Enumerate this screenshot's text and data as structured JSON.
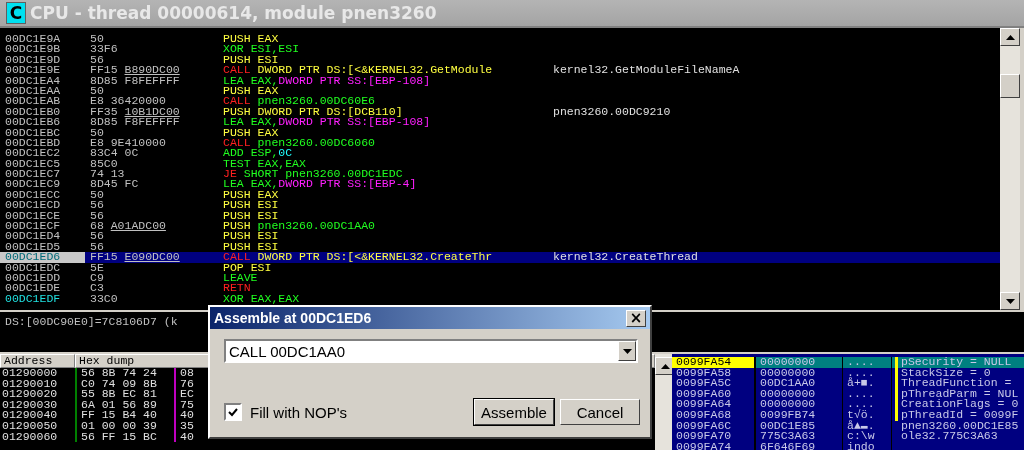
{
  "window": {
    "icon_letter": "C",
    "title": "CPU - thread 00000614, module pnen3260"
  },
  "disassembly": {
    "rows": [
      {
        "address": "00DC1E9A",
        "hex": "50",
        "asm": [
          {
            "text": "PUSH",
            "kind": "push"
          },
          {
            "text": "EAX",
            "kind": "push"
          }
        ],
        "comment": "",
        "selected": false,
        "highlighted": false
      },
      {
        "address": "00DC1E9B",
        "hex": "33F6",
        "asm": [
          {
            "text": "XOR",
            "kind": "cmd"
          },
          {
            "text": "ESI,ESI",
            "kind": "cmd"
          }
        ],
        "comment": "",
        "selected": false,
        "highlighted": false
      },
      {
        "address": "00DC1E9D",
        "hex": "56",
        "asm": [
          {
            "text": "PUSH",
            "kind": "push"
          },
          {
            "text": "ESI",
            "kind": "push"
          }
        ],
        "comment": "",
        "selected": false,
        "highlighted": false
      },
      {
        "address": "00DC1E9E",
        "hex": "FF15",
        "fixup": "B890DC00",
        "asm": [
          {
            "text": "CALL",
            "kind": "call"
          },
          {
            "text": "DWORD PTR DS:[<&KERNEL32.GetModule",
            "kind": "push"
          }
        ],
        "comment": "kernel32.GetModuleFileNameA",
        "selected": false,
        "highlighted": false
      },
      {
        "address": "00DC1EA4",
        "hex": "8D85 F8FEFFFF",
        "asm": [
          {
            "text": "LEA",
            "kind": "cmd"
          },
          {
            "text": "EAX,",
            "kind": "cmd"
          },
          {
            "text": "DWORD PTR SS:[EBP-108]",
            "kind": "mem"
          }
        ],
        "comment": "",
        "selected": false,
        "highlighted": false
      },
      {
        "address": "00DC1EAA",
        "hex": "50",
        "asm": [
          {
            "text": "PUSH",
            "kind": "push"
          },
          {
            "text": "EAX",
            "kind": "push"
          }
        ],
        "comment": "",
        "selected": false,
        "highlighted": false
      },
      {
        "address": "00DC1EAB",
        "hex": "E8 36420000",
        "asm": [
          {
            "text": "CALL",
            "kind": "call"
          },
          {
            "text": "pnen3260.00DC60E6",
            "kind": "cmd"
          }
        ],
        "comment": "",
        "selected": false,
        "highlighted": false
      },
      {
        "address": "00DC1EB0",
        "hex": "FF35",
        "fixup": "10B1DC00",
        "asm": [
          {
            "text": "PUSH",
            "kind": "push"
          },
          {
            "text": "DWORD PTR DS:[DCB110]",
            "kind": "push"
          }
        ],
        "comment": "pnen3260.00DC9210",
        "selected": false,
        "highlighted": false
      },
      {
        "address": "00DC1EB6",
        "hex": "8D85 F8FEFFFF",
        "asm": [
          {
            "text": "LEA",
            "kind": "cmd"
          },
          {
            "text": "EAX,",
            "kind": "cmd"
          },
          {
            "text": "DWORD PTR SS:[EBP-108]",
            "kind": "mem"
          }
        ],
        "comment": "",
        "selected": false,
        "highlighted": false
      },
      {
        "address": "00DC1EBC",
        "hex": "50",
        "asm": [
          {
            "text": "PUSH",
            "kind": "push"
          },
          {
            "text": "EAX",
            "kind": "push"
          }
        ],
        "comment": "",
        "selected": false,
        "highlighted": false
      },
      {
        "address": "00DC1EBD",
        "hex": "E8 9E410000",
        "asm": [
          {
            "text": "CALL",
            "kind": "call"
          },
          {
            "text": "pnen3260.00DC6060",
            "kind": "cmd"
          }
        ],
        "comment": "",
        "selected": false,
        "highlighted": false
      },
      {
        "address": "00DC1EC2",
        "hex": "83C4 0C",
        "asm": [
          {
            "text": "ADD",
            "kind": "cmd"
          },
          {
            "text": "ESP,",
            "kind": "cmd"
          },
          {
            "text": "0C",
            "kind": "const"
          }
        ],
        "comment": "",
        "selected": false,
        "highlighted": false
      },
      {
        "address": "00DC1EC5",
        "hex": "85C0",
        "asm": [
          {
            "text": "TEST",
            "kind": "cmd"
          },
          {
            "text": "EAX,EAX",
            "kind": "cmd"
          }
        ],
        "comment": "",
        "selected": false,
        "highlighted": false
      },
      {
        "address": "00DC1EC7",
        "hex": "74 13",
        "asm": [
          {
            "text": "JE",
            "kind": "call"
          },
          {
            "text": "SHORT pnen3260.00DC1EDC",
            "kind": "cmd"
          }
        ],
        "comment": "",
        "selected": false,
        "highlighted": false
      },
      {
        "address": "00DC1EC9",
        "hex": "8D45 FC",
        "asm": [
          {
            "text": "LEA",
            "kind": "cmd"
          },
          {
            "text": "EAX,",
            "kind": "cmd"
          },
          {
            "text": "DWORD PTR SS:[EBP-4]",
            "kind": "mem"
          }
        ],
        "comment": "",
        "selected": false,
        "highlighted": false
      },
      {
        "address": "00DC1ECC",
        "hex": "50",
        "asm": [
          {
            "text": "PUSH",
            "kind": "push"
          },
          {
            "text": "EAX",
            "kind": "push"
          }
        ],
        "comment": "",
        "selected": false,
        "highlighted": false
      },
      {
        "address": "00DC1ECD",
        "hex": "56",
        "asm": [
          {
            "text": "PUSH",
            "kind": "push"
          },
          {
            "text": "ESI",
            "kind": "push"
          }
        ],
        "comment": "",
        "selected": false,
        "highlighted": false
      },
      {
        "address": "00DC1ECE",
        "hex": "56",
        "asm": [
          {
            "text": "PUSH",
            "kind": "push"
          },
          {
            "text": "ESI",
            "kind": "push"
          }
        ],
        "comment": "",
        "selected": false,
        "highlighted": false
      },
      {
        "address": "00DC1ECF",
        "hex": "68",
        "fixup": "A01ADC00",
        "asm": [
          {
            "text": "PUSH",
            "kind": "push"
          },
          {
            "text": "pnen3260.00DC1AA0",
            "kind": "cmd"
          }
        ],
        "comment": "",
        "selected": false,
        "highlighted": false
      },
      {
        "address": "00DC1ED4",
        "hex": "56",
        "asm": [
          {
            "text": "PUSH",
            "kind": "push"
          },
          {
            "text": "ESI",
            "kind": "push"
          }
        ],
        "comment": "",
        "selected": false,
        "highlighted": false
      },
      {
        "address": "00DC1ED5",
        "hex": "56",
        "asm": [
          {
            "text": "PUSH",
            "kind": "push"
          },
          {
            "text": "ESI",
            "kind": "push"
          }
        ],
        "comment": "",
        "selected": false,
        "highlighted": false
      },
      {
        "address": "00DC1ED6",
        "hex": "FF15",
        "fixup": "E090DC00",
        "asm": [
          {
            "text": "CALL",
            "kind": "call"
          },
          {
            "text": "DWORD PTR DS:[<&KERNEL32.CreateThr",
            "kind": "push"
          }
        ],
        "comment": "kernel32.CreateThread",
        "selected": true,
        "highlighted": true
      },
      {
        "address": "00DC1EDC",
        "hex": "5E",
        "asm": [
          {
            "text": "POP",
            "kind": "push"
          },
          {
            "text": "ESI",
            "kind": "push"
          }
        ],
        "comment": "",
        "selected": false,
        "highlighted": false
      },
      {
        "address": "00DC1EDD",
        "hex": "C9",
        "asm": [
          {
            "text": "LEAVE",
            "kind": "cmd"
          }
        ],
        "comment": "",
        "selected": false,
        "highlighted": false
      },
      {
        "address": "00DC1EDE",
        "hex": "C3",
        "asm": [
          {
            "text": "RETN",
            "kind": "call"
          }
        ],
        "comment": "",
        "selected": false,
        "highlighted": false
      },
      {
        "address": "00DC1EDF",
        "hex": "33C0",
        "asm": [
          {
            "text": "XOR",
            "kind": "cmd"
          },
          {
            "text": "EAX,EAX",
            "kind": "cmd"
          }
        ],
        "comment": "",
        "selected": false,
        "highlighted": true
      }
    ]
  },
  "info": {
    "text": "DS:[00DC90E0]=7C8106D7 (k"
  },
  "dump": {
    "columns": [
      "Address",
      "Hex dump"
    ],
    "rows": [
      {
        "address": "01290000",
        "group_1": "56 8B 74 24",
        "group_2": "08"
      },
      {
        "address": "01290010",
        "group_1": "C0 74 09 8B",
        "group_2": "76"
      },
      {
        "address": "01290020",
        "group_1": "55 8B EC 81",
        "group_2": "EC"
      },
      {
        "address": "01290030",
        "group_1": "6A 01 56 89",
        "group_2": "75"
      },
      {
        "address": "01290040",
        "group_1": "FF 15 B4 40",
        "group_2": "40"
      },
      {
        "address": "01290050",
        "group_1": "01 00 00 39",
        "group_2": "35"
      },
      {
        "address": "01290060",
        "group_1": "56 FF 15 BC",
        "group_2": "40"
      }
    ]
  },
  "stack": {
    "rows": [
      {
        "address": "0099FA54",
        "value": "00000000",
        "ascii": "....",
        "comment": "pSecurity = NULL",
        "selected": true,
        "bracket": true
      },
      {
        "address": "0099FA58",
        "value": "00000000",
        "ascii": "....",
        "comment": "StackSize = 0",
        "selected": false,
        "bracket": true
      },
      {
        "address": "0099FA5C",
        "value": "00DC1AA0",
        "ascii": "å+■.",
        "comment": "ThreadFunction =",
        "selected": false,
        "bracket": true
      },
      {
        "address": "0099FA60",
        "value": "00000000",
        "ascii": "....",
        "comment": "pThreadParm = NUL",
        "selected": false,
        "bracket": true
      },
      {
        "address": "0099FA64",
        "value": "00000000",
        "ascii": "....",
        "comment": "CreationFlags = 0",
        "selected": false,
        "bracket": true
      },
      {
        "address": "0099FA68",
        "value": "0099FB74",
        "ascii": "t√ö.",
        "comment": "pThreadId = 0099F",
        "selected": false,
        "bracket": true
      },
      {
        "address": "0099FA6C",
        "value": "00DC1E85",
        "ascii": "å▲▬.",
        "comment": "pnen3260.00DC1E85",
        "selected": false,
        "bracket": false
      },
      {
        "address": "0099FA70",
        "value": "775C3A63",
        "ascii": "c:\\w",
        "comment": "ole32.775C3A63",
        "selected": false,
        "bracket": false
      },
      {
        "address": "0099FA74",
        "value": "6F646F69",
        "ascii": "indo",
        "selected": false,
        "bracket": false
      }
    ]
  },
  "dialog": {
    "title": "Assemble at 00DC1ED6",
    "close": "×",
    "command": "CALL 00DC1AA0",
    "fill_nops": {
      "label": "Fill with NOP's",
      "checked": true
    },
    "buttons": [
      {
        "label": "Assemble",
        "default": true
      },
      {
        "label": "Cancel",
        "default": false
      }
    ]
  }
}
